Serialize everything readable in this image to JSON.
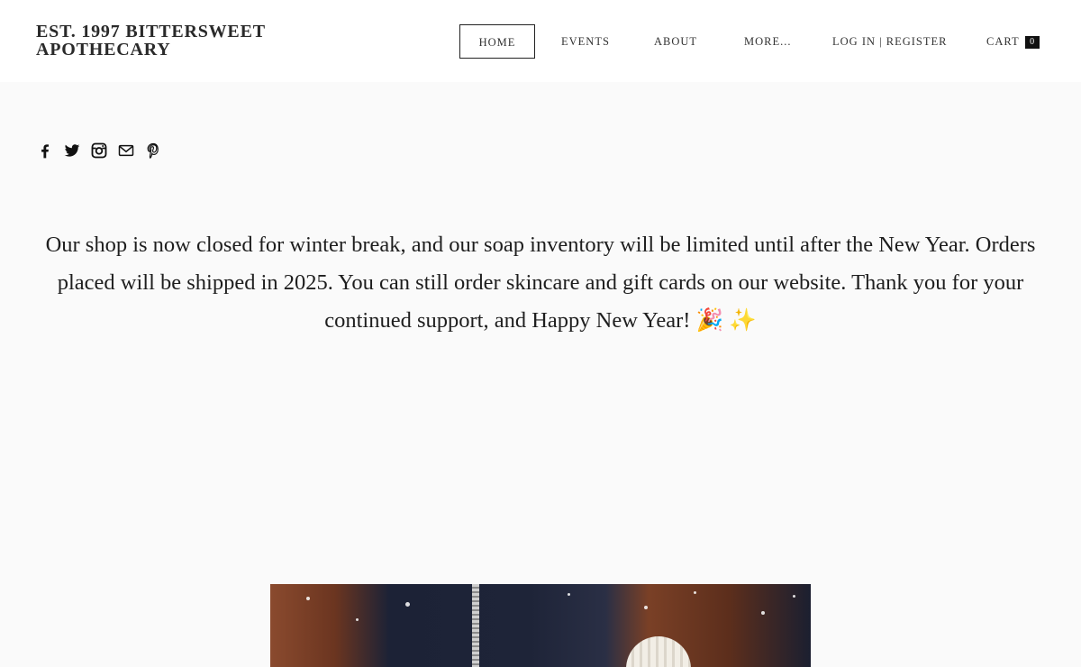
{
  "brand": {
    "line1": "EST. 1997 BITTERSWEET",
    "line2": "APOTHECARY"
  },
  "nav": {
    "home": "HOME",
    "events": "EVENTS",
    "about": "ABOUT",
    "more": "MORE...",
    "login": "LOG IN | REGISTER",
    "cart": "CART",
    "cart_count": "0"
  },
  "social": [
    "facebook-icon",
    "twitter-icon",
    "instagram-icon",
    "mail-icon",
    "pinterest-icon"
  ],
  "announcement": "Our shop is now closed for winter break, and our soap inventory will be limited until after the New Year. Orders placed will be shipped in 2025. You can still order skincare and gift cards on our website. Thank you for your continued support, and Happy New Year! 🎉 ✨"
}
